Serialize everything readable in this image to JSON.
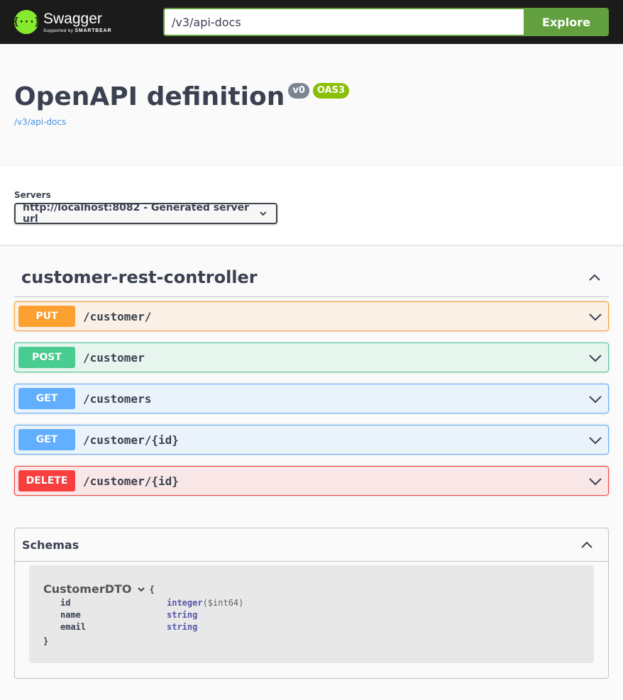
{
  "topbar": {
    "logo_name": "Swagger",
    "logo_sub_prefix": "Supported by",
    "logo_sub_brand": "SMARTBEAR",
    "url_value": "/v3/api-docs",
    "explore_label": "Explore"
  },
  "info": {
    "title": "OpenAPI definition",
    "version_badge": "v0",
    "oas_badge": "OAS3",
    "spec_link": "/v3/api-docs"
  },
  "servers": {
    "label": "Servers",
    "selected": "http://localhost:8082 - Generated server url"
  },
  "tag": {
    "name": "customer-rest-controller",
    "operations": [
      {
        "method": "PUT",
        "path": "/customer/"
      },
      {
        "method": "POST",
        "path": "/customer"
      },
      {
        "method": "GET",
        "path": "/customers"
      },
      {
        "method": "GET",
        "path": "/customer/{id}"
      },
      {
        "method": "DELETE",
        "path": "/customer/{id}"
      }
    ]
  },
  "schemas": {
    "title": "Schemas",
    "model": {
      "name": "CustomerDTO",
      "open_brace": "{",
      "close_brace": "}",
      "properties": [
        {
          "name": "id",
          "type": "integer",
          "format": "($int64)"
        },
        {
          "name": "name",
          "type": "string",
          "format": ""
        },
        {
          "name": "email",
          "type": "string",
          "format": ""
        }
      ]
    }
  },
  "colors": {
    "put": "#fca130",
    "post": "#49cc90",
    "get": "#61affe",
    "delete": "#f93e3e",
    "explore": "#62a03f"
  }
}
